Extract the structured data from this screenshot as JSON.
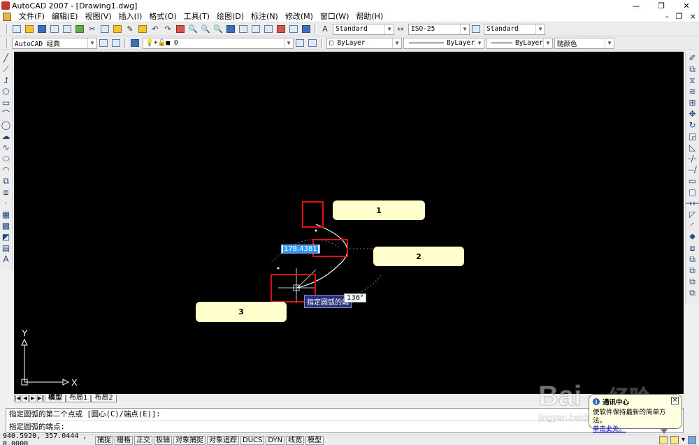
{
  "window": {
    "title": "AutoCAD 2007 - [Drawing1.dwg]",
    "controls": [
      "—",
      "❐",
      "✕"
    ]
  },
  "menubar": {
    "items": [
      "文件(F)",
      "编辑(E)",
      "视图(V)",
      "插入(I)",
      "格式(O)",
      "工具(T)",
      "绘图(D)",
      "标注(N)",
      "修改(M)",
      "窗口(W)",
      "帮助(H)"
    ],
    "doc_controls": [
      "–",
      "❐",
      "×"
    ]
  },
  "toolbar_standard": {
    "text_style": "Standard",
    "dim_style": "ISO-25",
    "table_style": "Standard"
  },
  "toolbar_layers": {
    "workspace": "AutoCAD 经典",
    "layer": "0",
    "color": "ByLayer",
    "linetype": "ByLayer",
    "lineweight": "ByLayer",
    "plot_style": "随颜色"
  },
  "canvas": {
    "callouts": [
      "1",
      "2",
      "3"
    ],
    "dynamic_input_value": "178.4381",
    "dynamic_prompt": "指定圆弧的端",
    "angle_value": "136°",
    "ucs_x": "X",
    "ucs_y": "Y"
  },
  "layout_tabs": {
    "tabs": [
      "模型",
      "布局1",
      "布局2"
    ],
    "active": "模型"
  },
  "command": {
    "history": "指定圆弧的第二个点或 [圆心(C)/端点(E)]:",
    "prompt": "指定圆弧的端点:"
  },
  "statusbar": {
    "coords": "940.5920,  357.0444 , 0.0000",
    "modes": [
      "捕捉",
      "栅格",
      "正交",
      "极轴",
      "对象捕捉",
      "对象追踪",
      "DUCS",
      "DYN",
      "线宽",
      "模型"
    ]
  },
  "balloon": {
    "title": "通讯中心",
    "body": "使软件保持最新的简单方法。",
    "link": "单击此处。"
  },
  "watermark": {
    "text": "Bai",
    "text2": "经验",
    "sub": "jingyan.baidu.com"
  },
  "colors": {
    "canvas_bg": "#000000",
    "callout_bg": "#ffffcc",
    "highlight_box": "#e01010",
    "arc": "#ffffff"
  }
}
